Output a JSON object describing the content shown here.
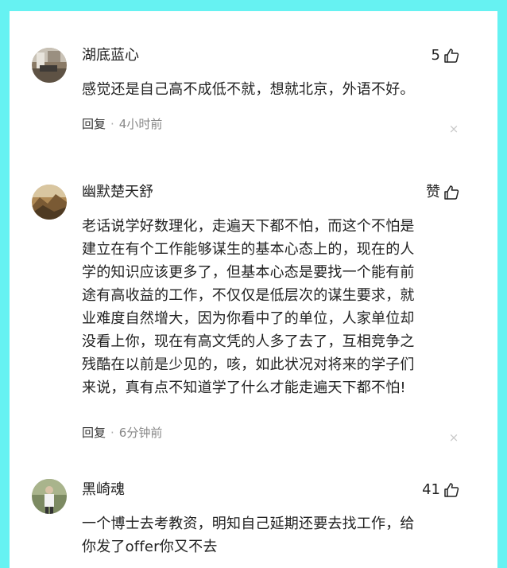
{
  "comments": [
    {
      "username": "湖底蓝心",
      "likes": "5",
      "lines": [
        "感觉还是自己高不成低不就，想就北京，外语不好。"
      ],
      "reply_label": "回复",
      "separator": "·",
      "time": "4小时前",
      "close_glyph": "×"
    },
    {
      "username": "幽默楚天舒",
      "likes": "赞",
      "lines": [
        "老话说学好数理化，走遍天下都不怕，而这个不怕是",
        "建立在有个工作能够谋生的基本心态上的，现在的人",
        "学的知识应该更多了，但基本心态是要找一个能有前",
        "途有高收益的工作，不仅仅是低层次的谋生要求，就",
        "业难度自然增大，因为你看中了的单位，人家单位却",
        "没看上你，现在有高文凭的人多了去了，互相竞争之",
        "残酷在以前是少见的，咳，如此状况对将来的学子们",
        "来说，真有点不知道学了什么才能走遍天下都不怕!"
      ],
      "reply_label": "回复",
      "separator": "·",
      "time": "6分钟前",
      "close_glyph": "×"
    },
    {
      "username": "黑崎魂",
      "likes": "41",
      "lines": [
        "一个博士去考教资，明知自己延期还要去找工作，给",
        "你发了offer你又不去"
      ]
    }
  ]
}
